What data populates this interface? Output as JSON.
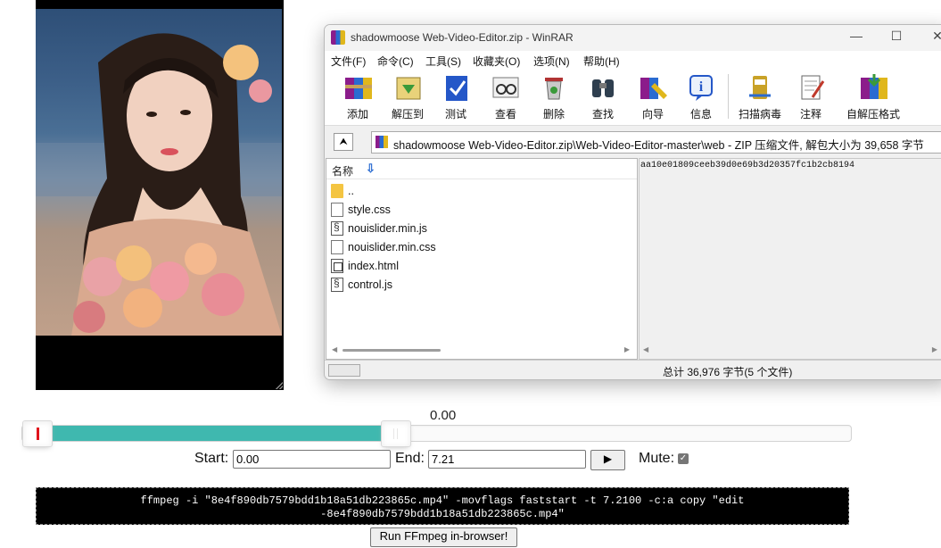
{
  "player": {
    "time_readout": "0.00",
    "start_label": "Start:",
    "start_value": "0.00",
    "end_label": "End:",
    "end_value": "7.21",
    "play_symbol": "▶",
    "mute_label": "Mute:",
    "mute_checked": true,
    "range_fraction": [
      0.0,
      0.45
    ],
    "command": "ffmpeg -i \"8e4f890db7579bdd1b18a51db223865c.mp4\" -movflags faststart -t 7.2100 -c:a copy \"edit -8e4f890db7579bdd1b18a51db223865c.mp4\"",
    "run_button": "Run FFmpeg in-browser!"
  },
  "winrar": {
    "title": "shadowmoose Web-Video-Editor.zip - WinRAR",
    "window_controls": {
      "minimize": "—",
      "maximize": "☐",
      "close": "✕"
    },
    "menu": [
      "文件(F)",
      "命令(C)",
      "工具(S)",
      "收藏夹(O)",
      "选项(N)",
      "帮助(H)"
    ],
    "toolbar": [
      "添加",
      "解压到",
      "测试",
      "查看",
      "删除",
      "查找",
      "向导",
      "信息",
      "扫描病毒",
      "注释",
      "自解压格式"
    ],
    "up_symbol": "⮝",
    "address": "shadowmoose Web-Video-Editor.zip\\Web-Video-Editor-master\\web - ZIP 压缩文件, 解包大小为 39,658 字节",
    "column_name": "名称",
    "files": [
      {
        "name": "..",
        "icon": "folder-icon"
      },
      {
        "name": "style.css",
        "icon": "document-icon"
      },
      {
        "name": "nouislider.min.js",
        "icon": "script-icon"
      },
      {
        "name": "nouislider.min.css",
        "icon": "document-icon"
      },
      {
        "name": "index.html",
        "icon": "web-page-icon"
      },
      {
        "name": "control.js",
        "icon": "script-icon"
      }
    ],
    "comment": "aa10e01809ceeb39d0e69b3d20357fc1b2cb8194",
    "status": "总计 36,976 字节(5 个文件)"
  }
}
